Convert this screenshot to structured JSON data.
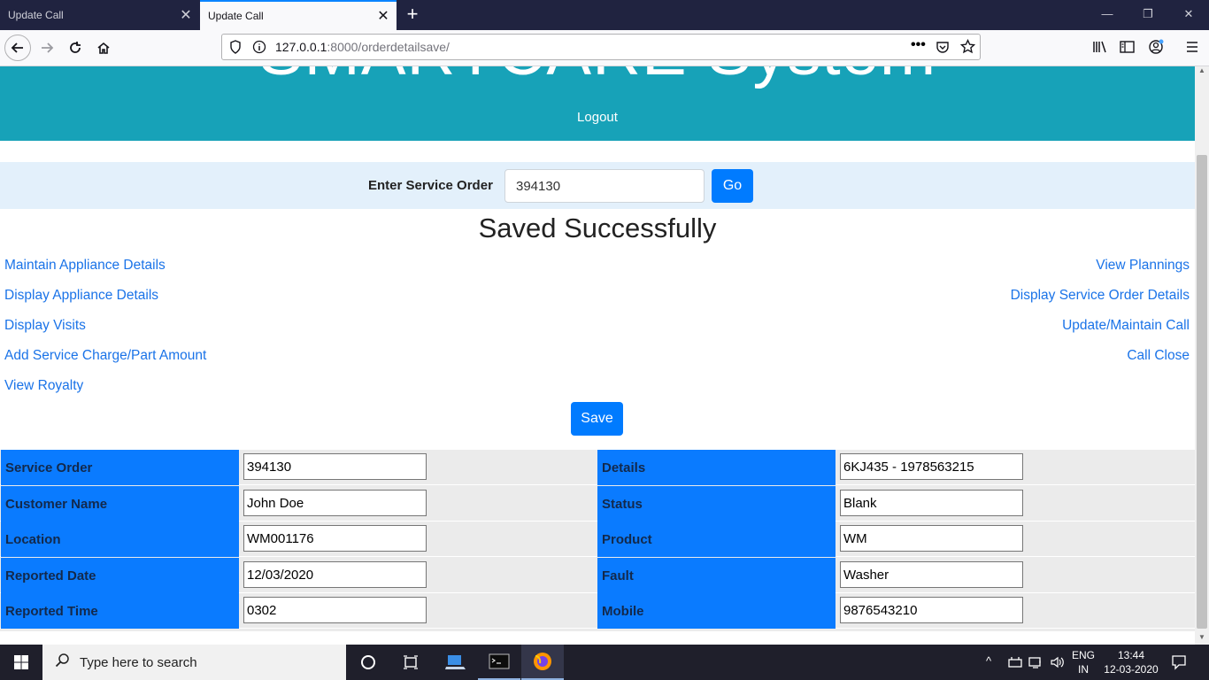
{
  "browser": {
    "tabs": [
      {
        "label": "Update Call"
      },
      {
        "label": "Update Call"
      }
    ],
    "url_host": "127.0.0.1",
    "url_rest": ":8000/orderdetailsave/"
  },
  "header": {
    "title": "SMARTCARE System",
    "logout": "Logout"
  },
  "search": {
    "label": "Enter Service Order",
    "value": "394130",
    "go": "Go"
  },
  "message": "Saved Successfully",
  "links_left": [
    "Maintain Appliance Details",
    "Display Appliance Details",
    "Display Visits",
    "Add Service Charge/Part Amount",
    "View Royalty"
  ],
  "links_right": [
    "View Plannings",
    "Display Service Order Details",
    "Update/Maintain Call",
    "Call Close"
  ],
  "save_label": "Save",
  "form": {
    "left": [
      {
        "label": "Service Order",
        "value": "394130"
      },
      {
        "label": "Customer Name",
        "value": "John Doe"
      },
      {
        "label": "Location",
        "value": "WM001176"
      },
      {
        "label": "Reported Date",
        "value": "12/03/2020"
      },
      {
        "label": "Reported Time",
        "value": "0302"
      }
    ],
    "right": [
      {
        "label": "Details",
        "value": "6KJ435 - 1978563215"
      },
      {
        "label": "Status",
        "value": "Blank"
      },
      {
        "label": "Product",
        "value": "WM"
      },
      {
        "label": "Fault",
        "value": "Washer"
      },
      {
        "label": "Mobile",
        "value": "9876543210"
      }
    ]
  },
  "taskbar": {
    "search_placeholder": "Type here to search",
    "lang_line1": "ENG",
    "lang_line2": "IN",
    "time": "13:44",
    "date": "12-03-2020"
  },
  "colors": {
    "banner": "#17a2b8",
    "primary": "#007bff",
    "link": "#1a73e8",
    "label_cell": "#0a7bff"
  }
}
